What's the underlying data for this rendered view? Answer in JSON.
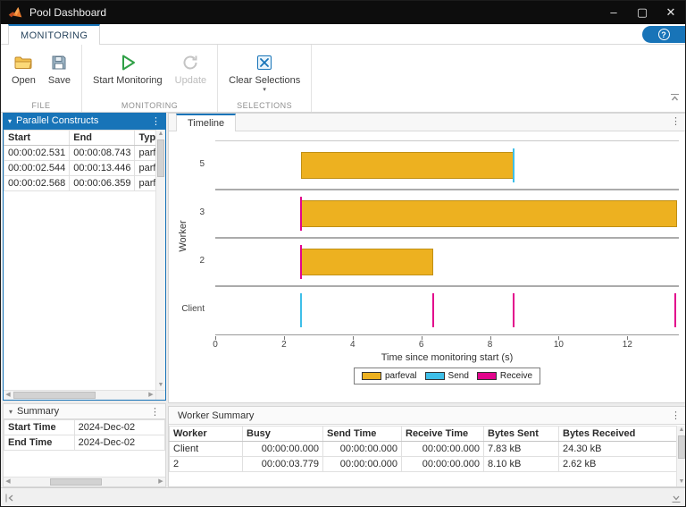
{
  "window": {
    "title": "Pool Dashboard",
    "controls": {
      "minimize": "–",
      "maximize": "▢",
      "close": "✕"
    }
  },
  "icons": {
    "kebab": "⋮",
    "collapse": "▾",
    "dropdown": "▾",
    "scroll_up": "▲",
    "scroll_down": "▼",
    "scroll_left": "◀",
    "scroll_right": "▶"
  },
  "colors": {
    "accent_blue": "#1874B8",
    "parfeval": "#EDB120",
    "send": "#3EBFE8",
    "receive": "#E2058C"
  },
  "ribbon": {
    "active_tab": "MONITORING",
    "help_icon": "?",
    "groups": [
      {
        "label": "FILE",
        "buttons": [
          {
            "label": "Open",
            "icon": "folder-icon",
            "enabled": true
          },
          {
            "label": "Save",
            "icon": "save-icon",
            "enabled": true
          }
        ]
      },
      {
        "label": "MONITORING",
        "buttons": [
          {
            "label": "Start Monitoring",
            "icon": "play-icon",
            "enabled": true
          },
          {
            "label": "Update",
            "icon": "refresh-icon",
            "enabled": false
          }
        ]
      },
      {
        "label": "SELECTIONS",
        "buttons": [
          {
            "label": "Clear Selections",
            "icon": "clear-selections-icon",
            "enabled": true,
            "dropdown": true
          }
        ]
      }
    ]
  },
  "constructs_panel": {
    "title": "Parallel Constructs",
    "columns": [
      "Start",
      "End",
      "Type"
    ],
    "rows": [
      [
        "00:00:02.531",
        "00:00:08.743",
        "parfev"
      ],
      [
        "00:00:02.544",
        "00:00:13.446",
        "parfev"
      ],
      [
        "00:00:02.568",
        "00:00:06.359",
        "parfev"
      ]
    ]
  },
  "summary_panel": {
    "title": "Summary",
    "rows": [
      [
        "Start Time",
        "2024-Dec-02"
      ],
      [
        "End Time",
        "2024-Dec-02"
      ]
    ]
  },
  "timeline_panel": {
    "tab": "Timeline",
    "chart_data": {
      "type": "timeline",
      "xlabel": "Time since monitoring start (s)",
      "ylabel": "Worker",
      "xlim": [
        0,
        13.5
      ],
      "xticks": [
        0,
        2,
        4,
        6,
        8,
        10,
        12
      ],
      "categories": [
        "5",
        "3",
        "2",
        "Client"
      ],
      "bars": [
        {
          "category": "5",
          "series": "parfeval",
          "start": 2.5,
          "end": 8.7
        },
        {
          "category": "3",
          "series": "parfeval",
          "start": 2.5,
          "end": 13.45
        },
        {
          "category": "2",
          "series": "parfeval",
          "start": 2.5,
          "end": 6.35
        }
      ],
      "events": [
        {
          "category": "5",
          "series": "Send",
          "t": 8.7
        },
        {
          "category": "3",
          "series": "Receive",
          "t": 2.5
        },
        {
          "category": "2",
          "series": "Receive",
          "t": 2.5
        },
        {
          "category": "Client",
          "series": "Send",
          "t": 2.5
        },
        {
          "category": "Client",
          "series": "Receive",
          "t": 6.35
        },
        {
          "category": "Client",
          "series": "Receive",
          "t": 8.7
        },
        {
          "category": "Client",
          "series": "Receive",
          "t": 13.4
        }
      ],
      "legend": [
        {
          "label": "parfeval",
          "series": "parfeval"
        },
        {
          "label": "Send",
          "series": "Send"
        },
        {
          "label": "Receive",
          "series": "Receive"
        }
      ]
    }
  },
  "worker_summary_panel": {
    "title": "Worker Summary",
    "columns": [
      "Worker",
      "Busy",
      "Send Time",
      "Receive Time",
      "Bytes Sent",
      "Bytes Received"
    ],
    "rows": [
      [
        "Client",
        "00:00:00.000",
        "00:00:00.000",
        "00:00:00.000",
        "7.83 kB",
        "24.30 kB"
      ],
      [
        "2",
        "00:00:03.779",
        "00:00:00.000",
        "00:00:00.000",
        "8.10 kB",
        "2.62 kB"
      ]
    ]
  }
}
